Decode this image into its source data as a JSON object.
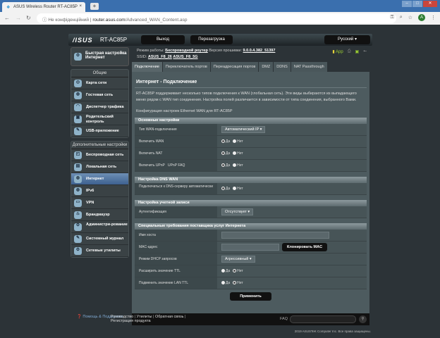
{
  "browser": {
    "tab_title": "ASUS Wireless Router RT-AC85P",
    "new_tab": "+",
    "not_secure": "Не конфіденційний",
    "url_host": "router.asus.com",
    "url_path": "/Advanced_WAN_Content.asp",
    "avatar": "A"
  },
  "header": {
    "logo": "/ISUS",
    "model": "RT-AC85P",
    "logout": "Выход",
    "reboot": "Перезагрузка",
    "language": "Русский"
  },
  "info": {
    "mode_label": "Режим работы:",
    "mode": "Беспроводной роутер",
    "fw_label": "Версия прошивки:",
    "fw": "9.0.0.4.382_51397",
    "ssid_label": "SSID:",
    "ssid1": "ASUS_F8_26",
    "ssid2": "ASUS_F8_5G",
    "app": "App"
  },
  "sidebar": {
    "quick": "Быстрая настройка Интернет",
    "general": "Общие",
    "general_items": [
      "Карта сети",
      "Гостевая сеть",
      "Диспетчер трафика",
      "Родительский контроль",
      "USB-приложение"
    ],
    "advanced": "Дополнительные настройки",
    "advanced_items": [
      "Беспроводная сеть",
      "Локальная сеть",
      "Интернет",
      "IPv6",
      "VPN",
      "Брандмауэр",
      "Администри-рование",
      "Системный журнал",
      "Сетевые утилиты"
    ]
  },
  "tabs": [
    "Подключение",
    "Переключатель портов",
    "Переадресация портов",
    "DMZ",
    "DDNS",
    "NAT Passthrough"
  ],
  "main": {
    "title": "Интернет - Подключение",
    "desc": "RT-AC85P поддерживает несколько типов подключения к WAN (глобальная сеть). Эти виды выбираются из выпадающего меню рядом с WAN тип соединения. Настройка полей различается в зависимости от типа соединения, выбранного Вами.",
    "config": "Конфигурация настроек Ethernet WAN для RT-AC85P",
    "yes": "Да",
    "no": "Нет",
    "basic": "Основные настройки",
    "wan_type": "Тип WAN-подключения",
    "wan_type_val": "Автоматический IP",
    "enable_wan": "Включить WAN",
    "enable_nat": "Включить NAT",
    "enable_upnp": "Включить UPnP",
    "upnp_faq": "UPnP FAQ",
    "dns": "Настройка DNS WAN",
    "dns_auto": "Подключаться к DNS-серверу автоматически",
    "account": "Настройка учетной записи",
    "auth": "Аутентификация",
    "auth_val": "Отсутствует",
    "isp": "Специальные требования поставщика услуг Интернета",
    "host": "Имя хоста",
    "mac": "MAC-адрес",
    "clone_mac": "Клонировать MAC",
    "dhcp": "Режим DHCP запросов",
    "dhcp_val": "Агрессивный",
    "ttl_ext": "Расширить значение TTL",
    "ttl_lan": "Подменить значение LAN TTL",
    "apply": "Применить"
  },
  "footer": {
    "help": "Помощь & Поддержка",
    "manual": "Руководство",
    "utils": "Утилиты",
    "feedback": "Обратная связь",
    "register": "Регистрация продукта",
    "faq": "FAQ",
    "copyright": "2019 ASUSTeK Computer Inc. Все права защищены."
  }
}
